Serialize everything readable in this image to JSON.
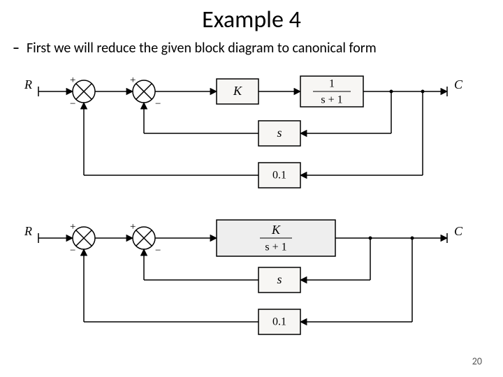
{
  "title": "Example 4",
  "bullet_dash": "–",
  "bullet_text": "First we will reduce the given block diagram to canonical form",
  "page_number": "20",
  "diagram1": {
    "input_label": "R",
    "output_label": "C",
    "sum1": {
      "plus": "+",
      "minus": "−"
    },
    "sum2": {
      "plus": "+",
      "minus": "−"
    },
    "block_K": "K",
    "block_frac": {
      "num": "1",
      "den": "s + 1"
    },
    "block_s": "s",
    "block_gain": "0.1"
  },
  "diagram2": {
    "input_label": "R",
    "output_label": "C",
    "sum1": {
      "plus": "+",
      "minus": "−"
    },
    "sum2": {
      "plus": "+",
      "minus": "−"
    },
    "block_combined": {
      "num": "K",
      "den": "s + 1"
    },
    "block_s": "s",
    "block_gain": "0.1"
  }
}
